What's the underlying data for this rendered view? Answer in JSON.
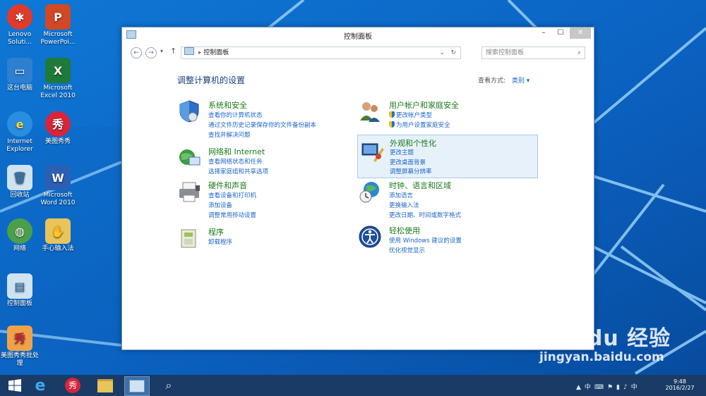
{
  "desktop": {
    "icons": [
      {
        "label": "Lenovo Soluti...",
        "icon": "lenovo-solutions-icon"
      },
      {
        "label": "Microsoft PowerPoi...",
        "icon": "powerpoint-icon"
      },
      {
        "label": "这台电脑",
        "icon": "this-pc-icon"
      },
      {
        "label": "Microsoft Excel 2010",
        "icon": "excel-icon"
      },
      {
        "label": "Internet Explorer",
        "icon": "ie-icon"
      },
      {
        "label": "美图秀秀",
        "icon": "meitu-icon"
      },
      {
        "label": "回收站",
        "icon": "recycle-bin-icon"
      },
      {
        "label": "Microsoft Word 2010",
        "icon": "word-icon"
      },
      {
        "label": "网络",
        "icon": "network-icon"
      },
      {
        "label": "手心输入法",
        "icon": "input-method-icon"
      },
      {
        "label": "控制面板",
        "icon": "control-panel-icon"
      },
      {
        "label": "美图秀秀批处理",
        "icon": "meitu-batch-icon"
      }
    ]
  },
  "window": {
    "title": "控制面板",
    "address": "控制面板",
    "search_placeholder": "搜索控制面板",
    "heading": "调整计算机的设置",
    "view_by_label": "查看方式:",
    "view_by_value": "类别 ▾",
    "categories": [
      {
        "title": "系统和安全",
        "links": [
          "查看你的计算机状态",
          "通过文件历史记录保存你的文件备份副本",
          "查找并解决问题"
        ],
        "icon": "shield-icon"
      },
      {
        "title": "网络和 Internet",
        "links": [
          "查看网络状态和任务",
          "选择家庭组和共享选项"
        ],
        "icon": "network-globe-icon"
      },
      {
        "title": "硬件和声音",
        "links": [
          "查看设备和打印机",
          "添加设备",
          "调整常用移动设置"
        ],
        "icon": "printer-icon"
      },
      {
        "title": "程序",
        "links": [
          "卸载程序"
        ],
        "icon": "programs-icon"
      },
      {
        "title": "用户帐户和家庭安全",
        "links": [
          "更改帐户类型",
          "为用户设置家庭安全"
        ],
        "icon": "users-icon"
      },
      {
        "title": "外观和个性化",
        "links": [
          "更改主题",
          "更改桌面背景",
          "调整屏幕分辨率"
        ],
        "icon": "appearance-icon"
      },
      {
        "title": "时钟、语言和区域",
        "links": [
          "添加语言",
          "更换输入法",
          "更改日期、时间或数字格式"
        ],
        "icon": "clock-globe-icon"
      },
      {
        "title": "轻松使用",
        "links": [
          "使用 Windows 建议的设置",
          "优化视觉显示"
        ],
        "icon": "ease-of-access-icon"
      }
    ]
  },
  "taskbar": {
    "time": "9:48",
    "date": "2016/2/27"
  },
  "watermark": {
    "brand": "Bai du 经验",
    "url": "jingyan.baidu.com"
  },
  "colors": {
    "wallpaper": "#0a5fb6",
    "link": "#1e64c8",
    "category_title": "#1a7a1a",
    "taskbar": "#1a3b66"
  }
}
